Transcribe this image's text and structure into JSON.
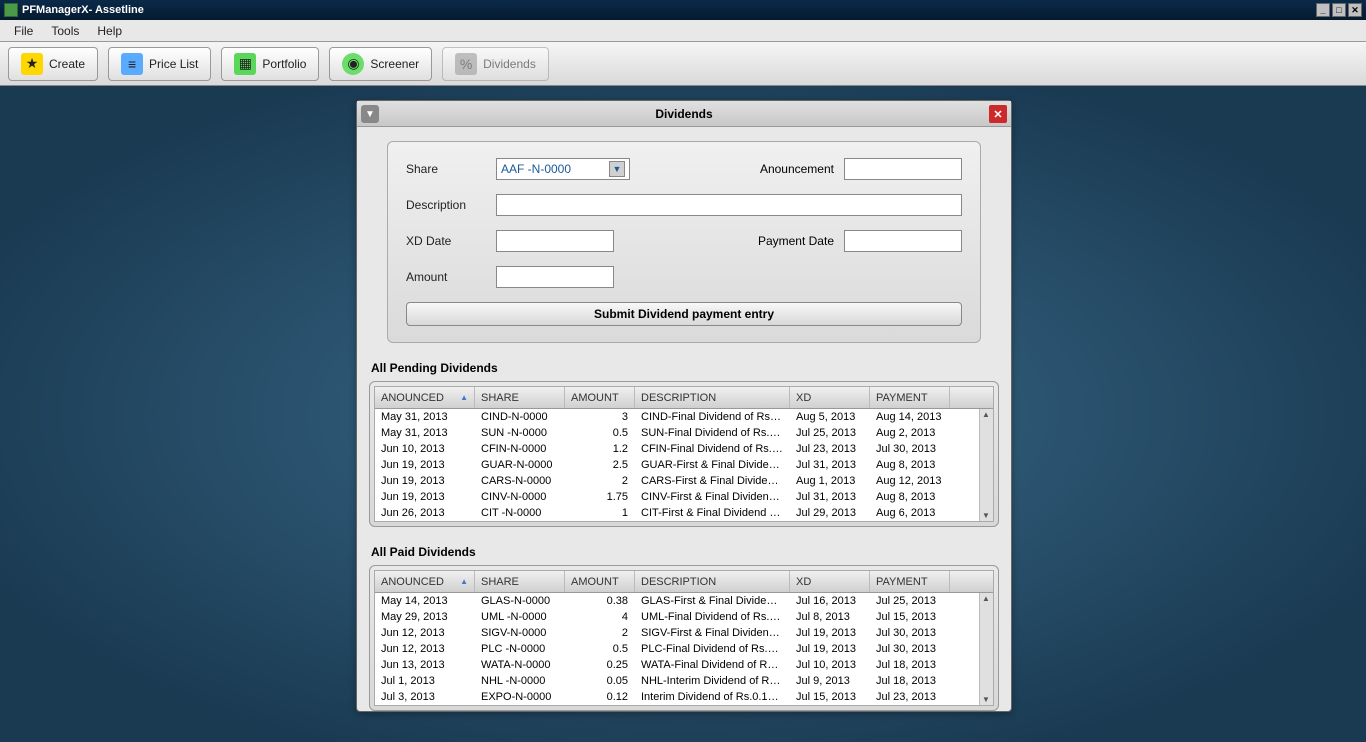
{
  "window": {
    "title": "PFManagerX- Assetline"
  },
  "menu": {
    "file": "File",
    "tools": "Tools",
    "help": "Help"
  },
  "toolbar": {
    "create": "Create",
    "pricelist": "Price List",
    "portfolio": "Portfolio",
    "screener": "Screener",
    "dividends": "Dividends"
  },
  "panel": {
    "title": "Dividends",
    "form": {
      "share_label": "Share",
      "share_value": "AAF -N-0000",
      "anouncement_label": "Anouncement",
      "anouncement_value": "",
      "description_label": "Description",
      "description_value": "",
      "xd_label": "XD Date",
      "xd_value": "",
      "payment_label": "Payment Date",
      "payment_value": "",
      "amount_label": "Amount",
      "amount_value": "",
      "submit": "Submit Dividend payment entry"
    },
    "pending_label": "All Pending Dividends",
    "paid_label": "All Paid Dividends",
    "columns": {
      "anounced": "ANOUNCED",
      "share": "SHARE",
      "amount": "AMOUNT",
      "description": "DESCRIPTION",
      "xd": "XD",
      "payment": "PAYMENT"
    },
    "pending": [
      {
        "anounced": "May 31, 2013",
        "share": "CIND-N-0000",
        "amount": "3",
        "desc": "CIND-Final Dividend of Rs.3…",
        "xd": "Aug 5, 2013",
        "pay": "Aug 14, 2013"
      },
      {
        "anounced": "May 31, 2013",
        "share": "SUN -N-0000",
        "amount": "0.5",
        "desc": "SUN-Final Dividend of Rs.0…",
        "xd": "Jul 25, 2013",
        "pay": "Aug 2, 2013"
      },
      {
        "anounced": "Jun 10, 2013",
        "share": "CFIN-N-0000",
        "amount": "1.2",
        "desc": "CFIN-Final Dividend of Rs.1…",
        "xd": "Jul 23, 2013",
        "pay": "Jul 30, 2013"
      },
      {
        "anounced": "Jun 19, 2013",
        "share": "GUAR-N-0000",
        "amount": "2.5",
        "desc": "GUAR-First & Final Dividen…",
        "xd": "Jul 31, 2013",
        "pay": "Aug 8, 2013"
      },
      {
        "anounced": "Jun 19, 2013",
        "share": "CARS-N-0000",
        "amount": "2",
        "desc": "CARS-First & Final Dividend…",
        "xd": "Aug 1, 2013",
        "pay": "Aug 12, 2013"
      },
      {
        "anounced": "Jun 19, 2013",
        "share": "CINV-N-0000",
        "amount": "1.75",
        "desc": "CINV-First & Final Dividend…",
        "xd": "Jul 31, 2013",
        "pay": "Aug 8, 2013"
      },
      {
        "anounced": "Jun 26, 2013",
        "share": "CIT -N-0000",
        "amount": "1",
        "desc": "CIT-First & Final Dividend o…",
        "xd": "Jul 29, 2013",
        "pay": "Aug 6, 2013"
      }
    ],
    "paid": [
      {
        "anounced": "May 14, 2013",
        "share": "GLAS-N-0000",
        "amount": "0.38",
        "desc": "GLAS-First & Final Dividend…",
        "xd": "Jul 16, 2013",
        "pay": "Jul 25, 2013"
      },
      {
        "anounced": "May 29, 2013",
        "share": "UML -N-0000",
        "amount": "4",
        "desc": "UML-Final Dividend of Rs.4…",
        "xd": "Jul 8, 2013",
        "pay": "Jul 15, 2013"
      },
      {
        "anounced": "Jun 12, 2013",
        "share": "SIGV-N-0000",
        "amount": "2",
        "desc": "SIGV-First & Final Dividend …",
        "xd": "Jul 19, 2013",
        "pay": "Jul 30, 2013"
      },
      {
        "anounced": "Jun 12, 2013",
        "share": "PLC -N-0000",
        "amount": "0.5",
        "desc": "PLC-Final Dividend of Rs.0…",
        "xd": "Jul 19, 2013",
        "pay": "Jul 30, 2013"
      },
      {
        "anounced": "Jun 13, 2013",
        "share": "WATA-N-0000",
        "amount": "0.25",
        "desc": "WATA-Final Dividend of Rs…",
        "xd": "Jul 10, 2013",
        "pay": "Jul 18, 2013"
      },
      {
        "anounced": "Jul 1, 2013",
        "share": "NHL -N-0000",
        "amount": "0.05",
        "desc": "NHL-Interim Dividend of Rs…",
        "xd": "Jul 9, 2013",
        "pay": "Jul 18, 2013"
      },
      {
        "anounced": "Jul 3, 2013",
        "share": "EXPO-N-0000",
        "amount": "0.12",
        "desc": "Interim Dividend of Rs.0.12…",
        "xd": "Jul 15, 2013",
        "pay": "Jul 23, 2013"
      }
    ]
  }
}
